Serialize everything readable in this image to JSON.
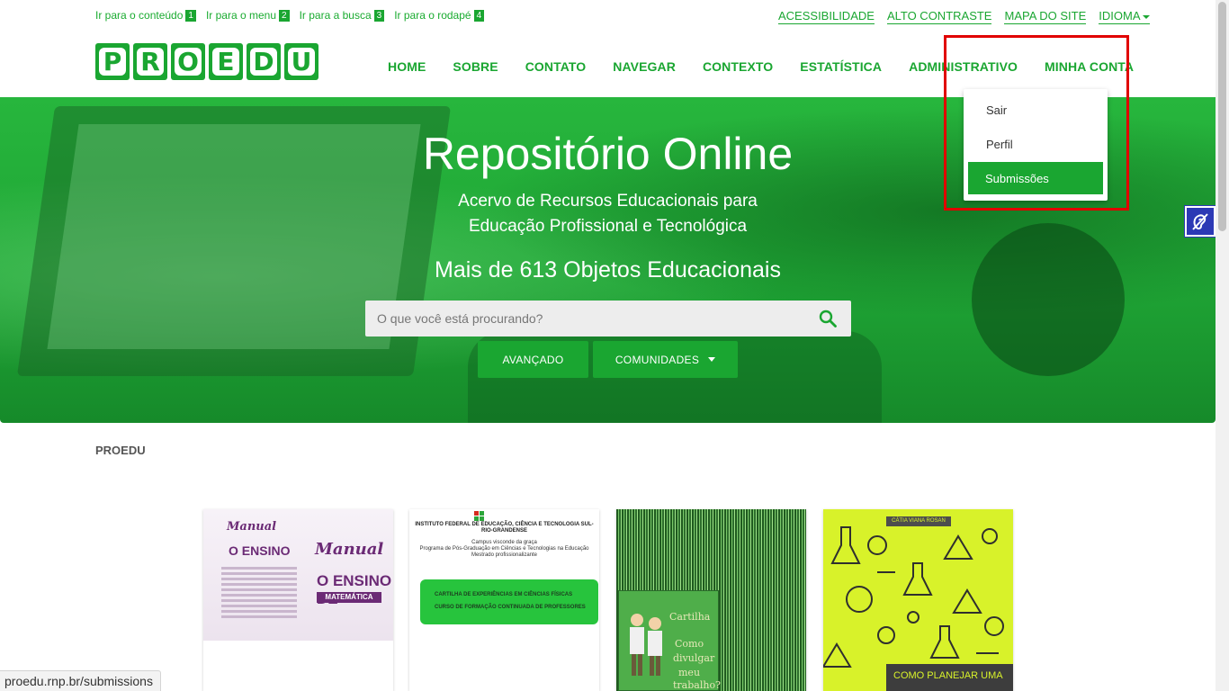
{
  "skip_links": [
    {
      "label": "Ir para o conteúdo",
      "num": "1"
    },
    {
      "label": "Ir para o menu",
      "num": "2"
    },
    {
      "label": "Ir para a busca",
      "num": "3"
    },
    {
      "label": "Ir para o rodapé",
      "num": "4"
    }
  ],
  "utility_links": {
    "accessibility": "ACESSIBILIDADE",
    "contrast": "ALTO CONTRASTE",
    "sitemap": "MAPA DO SITE",
    "language": "IDIOMA"
  },
  "logo": {
    "letters": [
      "P",
      "R",
      "O",
      "E",
      "D",
      "U"
    ]
  },
  "nav": {
    "home": "HOME",
    "about": "SOBRE",
    "contact": "CONTATO",
    "browse": "NAVEGAR",
    "context": "CONTEXTO",
    "stats": "ESTATÍSTICA",
    "admin": "ADMINISTRATIVO",
    "account": "MINHA CONTA"
  },
  "account_menu": {
    "logout": "Sair",
    "profile": "Perfil",
    "submissions": "Submissões"
  },
  "hero": {
    "title": "Repositório Online",
    "subtitle_line1": "Acervo de Recursos Educacionais para",
    "subtitle_line2": "Educação Profissional e Tecnológica",
    "count": "Mais de 613 Objetos Educacionais"
  },
  "search": {
    "placeholder": "O que você está procurando?",
    "advanced_label": "AVANÇADO",
    "communities_label": "COMUNIDADES"
  },
  "breadcrumb": "PROEDU",
  "cards": {
    "c1": {
      "line1": "Manual",
      "line2": "O ENSINO",
      "line3": "Manual",
      "line4": "O ENSINO DE",
      "line5": "MATEMÁTICA"
    },
    "c2": {
      "institute": "INSTITUTO FEDERAL DE EDUCAÇÃO, CIÊNCIA E TECNOLOGIA SUL-RIO-GRANDENSE",
      "campus": "Campus visconde da graça",
      "program": "Programa de Pós-Graduação em Ciências e Tecnologias na Educação",
      "degree": "Mestrado profissionalizante",
      "box_line1": "CARTILHA DE EXPERIÊNCIAS EM CIÊNCIAS FÍSICAS",
      "box_line2": "CURSO DE FORMAÇÃO CONTINUADA DE PROFESSORES"
    },
    "c3": {
      "word1": "Cartilha",
      "word2": "Como",
      "word3": "divulgar",
      "word4": "meu",
      "word5": "trabalho?"
    },
    "c4": {
      "author": "CÁTIA VIANA ROSAN",
      "title": "COMO PLANEJAR UMA"
    }
  },
  "status_url": "proedu.rnp.br/submissions",
  "colors": {
    "brand_green": "#1aa631",
    "highlight_red": "#e10000",
    "libras_blue": "#2c39b5"
  }
}
